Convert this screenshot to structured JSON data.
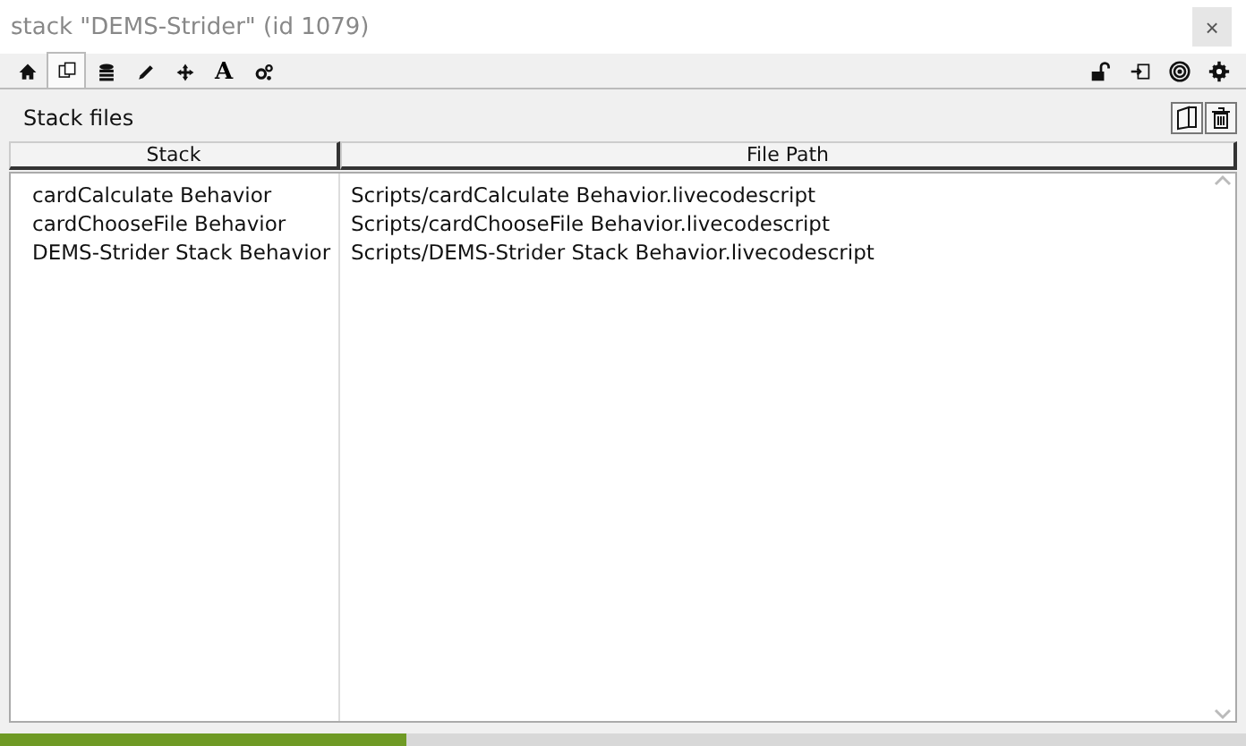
{
  "window": {
    "title": "stack \"DEMS-Strider\" (id 1079)",
    "close": "×"
  },
  "tabs": [
    {
      "kind": "home",
      "selected": false
    },
    {
      "kind": "copy",
      "selected": true
    },
    {
      "kind": "database",
      "selected": false
    },
    {
      "kind": "pencil",
      "selected": false
    },
    {
      "kind": "move",
      "selected": false
    },
    {
      "kind": "text",
      "label": "A",
      "selected": false
    },
    {
      "kind": "gears",
      "selected": false
    }
  ],
  "toolbar_right": [
    {
      "kind": "lock"
    },
    {
      "kind": "import"
    },
    {
      "kind": "target"
    },
    {
      "kind": "gear"
    }
  ],
  "section": {
    "title": "Stack files",
    "buttons": [
      {
        "kind": "folder"
      },
      {
        "kind": "trash"
      }
    ]
  },
  "table": {
    "columns": [
      "Stack",
      "File Path"
    ],
    "rows": [
      [
        "cardCalculate Behavior",
        "Scripts/cardCalculate Behavior.livecodescript"
      ],
      [
        "cardChooseFile Behavior",
        "Scripts/cardChooseFile Behavior.livecodescript"
      ],
      [
        "DEMS-Strider Stack Behavior",
        "Scripts/DEMS-Strider Stack Behavior.livecodescript"
      ]
    ]
  },
  "progress": {
    "level": 0.326
  }
}
